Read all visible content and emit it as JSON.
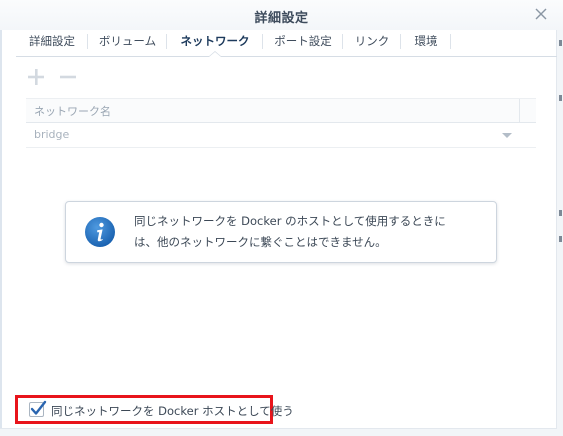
{
  "window": {
    "title": "詳細設定",
    "close_icon": "close-icon"
  },
  "tabs": [
    {
      "label": "詳細設定",
      "active": false
    },
    {
      "label": "ボリューム",
      "active": false
    },
    {
      "label": "ネットワーク",
      "active": true
    },
    {
      "label": "ポート設定",
      "active": false
    },
    {
      "label": "リンク",
      "active": false
    },
    {
      "label": "環境",
      "active": false
    }
  ],
  "toolbar": {
    "add_icon": "plus-icon",
    "remove_icon": "minus-icon"
  },
  "network_grid": {
    "columns": [
      "ネットワーク名"
    ],
    "rows": [
      {
        "network_name": "bridge"
      }
    ]
  },
  "info_message": {
    "icon": "info-icon",
    "lines": [
      "同じネットワークを Docker のホストとして使用するときに",
      "は、他のネットワークに繋ぐことはできません。"
    ]
  },
  "use_host_network": {
    "label": "同じネットワークを Docker ホストとして使う",
    "checked": true
  },
  "colors": {
    "highlight_border": "#e8141b",
    "info_icon_blue": "#1f6fc0",
    "checkmark": "#2a65b0"
  }
}
